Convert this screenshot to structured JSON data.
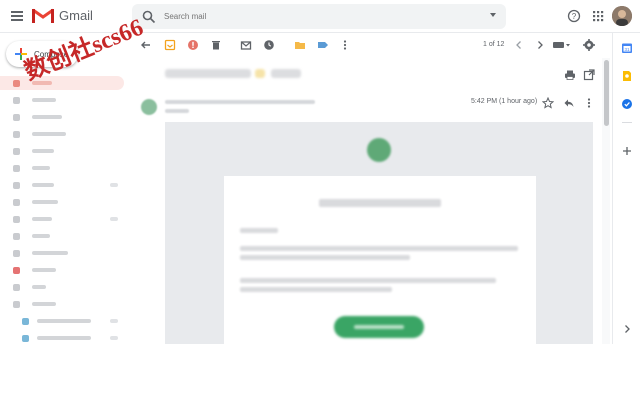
{
  "header": {
    "app_name": "Gmail",
    "search_placeholder": "Search mail"
  },
  "watermark": "数创社scs66",
  "sidebar": {
    "compose_label": "Compose"
  },
  "toolbar": {
    "pagination": "1 of 12"
  },
  "message": {
    "timestamp": "5:42 PM (1 hour ago)"
  },
  "colors": {
    "gmail_red": "#ea4335",
    "active_nav": "#fce8e6",
    "cta_green": "#3aa565",
    "body_bg": "#e8eaed"
  },
  "icons": {
    "header": [
      "menu-icon",
      "gmail-logo-icon",
      "search-icon",
      "help-icon",
      "apps-grid-icon"
    ],
    "toolbar": [
      "back-arrow-icon",
      "archive-icon",
      "report-spam-icon",
      "delete-icon",
      "mark-unread-icon",
      "snooze-icon",
      "move-to-icon",
      "labels-icon",
      "more-vert-icon",
      "prev-chevron-icon",
      "next-chevron-icon",
      "keyboard-icon",
      "settings-gear-icon"
    ],
    "message": [
      "print-icon",
      "open-new-window-icon",
      "star-icon",
      "reply-icon",
      "more-vert-icon"
    ],
    "side_panel": [
      "calendar-icon",
      "keep-icon",
      "tasks-icon",
      "add-icon",
      "expand-chevron-icon"
    ]
  }
}
